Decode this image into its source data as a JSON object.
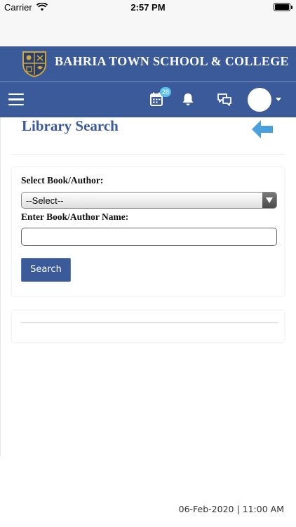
{
  "status_bar": {
    "carrier": "Carrier",
    "time": "2:57 PM"
  },
  "brand": {
    "title": "BAHRIA TOWN SCHOOL & COLLEGE",
    "color": "#3a5a9a"
  },
  "nav": {
    "calendar_badge": "28",
    "icons": [
      "hamburger-menu-icon",
      "calendar-icon",
      "bell-icon",
      "chat-icon",
      "avatar",
      "dropdown-caret-icon"
    ]
  },
  "page": {
    "title": "Library Search",
    "back_icon": "back-arrow-icon"
  },
  "form": {
    "select_label": "Select Book/Author:",
    "select_value": "--Select--",
    "name_label": "Enter Book/Author Name:",
    "name_value": "",
    "search_button": "Search"
  },
  "footer": {
    "datetime": "06-Feb-2020 | 11:00 AM"
  }
}
